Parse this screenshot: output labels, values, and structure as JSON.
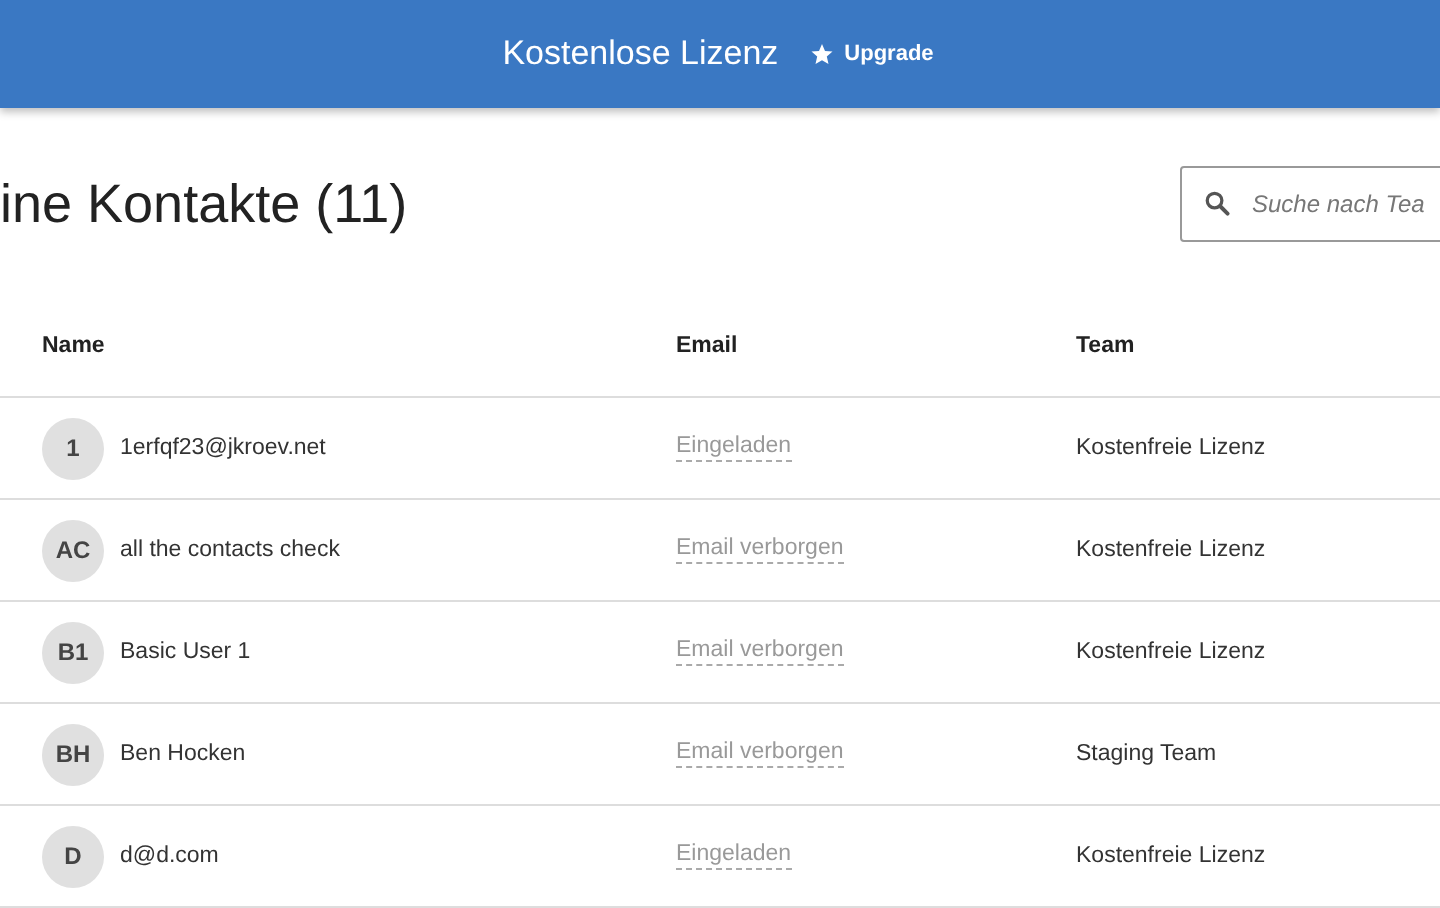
{
  "header": {
    "title": "Kostenlose Lizenz",
    "upgrade_label": "Upgrade"
  },
  "page_title": "ine Kontakte (11)",
  "search": {
    "placeholder": "Suche nach Tea"
  },
  "table": {
    "columns": [
      "Name",
      "Email",
      "Team"
    ],
    "rows": [
      {
        "initials": "1",
        "name": "1erfqf23@jkroev.net",
        "email": "Eingeladen",
        "team": "Kostenfreie Lizenz"
      },
      {
        "initials": "AC",
        "name": "all the contacts check",
        "email": "Email verborgen",
        "team": "Kostenfreie Lizenz"
      },
      {
        "initials": "B1",
        "name": "Basic User 1",
        "email": "Email verborgen",
        "team": "Kostenfreie Lizenz"
      },
      {
        "initials": "BH",
        "name": "Ben Hocken",
        "email": "Email verborgen",
        "team": "Staging Team"
      },
      {
        "initials": "D",
        "name": "d@d.com",
        "email": "Eingeladen",
        "team": "Kostenfreie Lizenz"
      }
    ]
  }
}
